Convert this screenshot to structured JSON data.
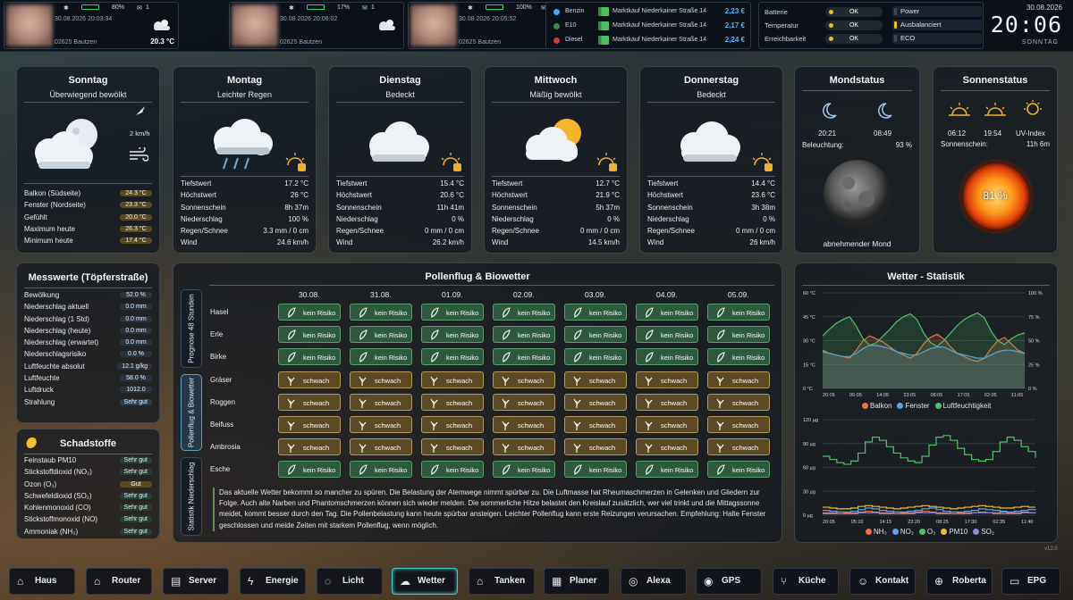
{
  "persons": [
    {
      "battery": "80%",
      "mail": "1",
      "time": "30.08.2026 20:03:34",
      "city": "02625 Bautzen",
      "temp": "20.3 °C"
    },
    {
      "battery": "17%",
      "mail": "1",
      "time": "30.08.2026 20:06:02",
      "city": "02625 Bautzen",
      "temp": ""
    },
    {
      "battery": "100%",
      "mail": "1",
      "time": "30.08.2026 20:05:52",
      "city": "02625 Bautzen",
      "temp": "20.8 °C"
    }
  ],
  "fuel": [
    {
      "name": "Benzin",
      "station": "Marktkauf Niederkainer Straße 14",
      "price": "2,23 €",
      "color": "#4aa3ff"
    },
    {
      "name": "E10",
      "station": "Marktkauf Niederkainer Straße 14",
      "price": "2,17 €",
      "color": "#3a8a4a"
    },
    {
      "name": "Diesel",
      "station": "Marktkauf Niederkainer Straße 14",
      "price": "2,24 €",
      "color": "#d93a3a"
    }
  ],
  "status": [
    {
      "label": "Batterie",
      "value": "OK"
    },
    {
      "label": "Temperatur",
      "value": "OK"
    },
    {
      "label": "Erreichbarkeit",
      "value": "OK"
    }
  ],
  "modes": [
    "Power",
    "Ausbalanciert",
    "ECO"
  ],
  "clock": {
    "date": "30.08.2026",
    "time": "20:06",
    "day": "SONNTAG"
  },
  "today": {
    "day": "Sonntag",
    "desc": "Überwiegend bewölkt",
    "wind": "2 km/h",
    "rows": [
      {
        "label": "Balkon (Südseite)",
        "value": "24.3 °C"
      },
      {
        "label": "Fenster (Nordseite)",
        "value": "23.3 °C"
      },
      {
        "label": "Gefühlt",
        "value": "20.0 °C"
      },
      {
        "label": "Maximum heute",
        "value": "26.3 °C"
      },
      {
        "label": "Minimum heute",
        "value": "17.4 °C"
      }
    ]
  },
  "forecast": [
    {
      "day": "Montag",
      "desc": "Leichter Regen",
      "rows": [
        "17.2 °C",
        "26 °C",
        "8h 37m",
        "100 %",
        "3.3 mm / 0 cm",
        "24.6 km/h"
      ]
    },
    {
      "day": "Dienstag",
      "desc": "Bedeckt",
      "rows": [
        "15.4 °C",
        "20.6 °C",
        "11h 41m",
        "0 %",
        "0 mm / 0 cm",
        "26.2 km/h"
      ]
    },
    {
      "day": "Mittwoch",
      "desc": "Mäßig bewölkt",
      "rows": [
        "12.7 °C",
        "21.9 °C",
        "5h 37m",
        "0 %",
        "0 mm / 0 cm",
        "14.5 km/h"
      ]
    },
    {
      "day": "Donnerstag",
      "desc": "Bedeckt",
      "rows": [
        "14.4 °C",
        "23.6 °C",
        "3h 38m",
        "0 %",
        "0 mm / 0 cm",
        "26 km/h"
      ]
    }
  ],
  "forecast_labels": [
    "Tiefstwert",
    "Höchstwert",
    "Sonnenschein",
    "Niederschlag",
    "Regen/Schnee",
    "Wind"
  ],
  "moon": {
    "title": "Mondstatus",
    "rise": "20:21",
    "set": "08:49",
    "illum_label": "Beleuchtung:",
    "illum": "93 %",
    "phase": "abnehmender Mond"
  },
  "sun": {
    "title": "Sonnenstatus",
    "rise": "06:12",
    "set": "19:54",
    "uv_label": "UV-Index",
    "shine_label": "Sonnenschein:",
    "shine": "11h 6m",
    "percent": "81 %",
    "percent_value": 81
  },
  "messwerte": {
    "title": "Messwerte (Töpferstraße)",
    "rows": [
      {
        "label": "Bewölkung",
        "value": "52.0 %"
      },
      {
        "label": "Niederschlag aktuell",
        "value": "0.0 mm"
      },
      {
        "label": "Niederschlag (1 Std)",
        "value": "0.0 mm"
      },
      {
        "label": "Niederschlag (heute)",
        "value": "0.0 mm"
      },
      {
        "label": "Niederschlag (erwartet)",
        "value": "0.0 mm"
      },
      {
        "label": "Niederschlagsrisiko",
        "value": "0.0 %"
      },
      {
        "label": "Luftfeuchte absolut",
        "value": "12.1 g/kg"
      },
      {
        "label": "Luftfeuchte",
        "value": "58.0 %"
      },
      {
        "label": "Luftdruck",
        "value": "1012.0"
      },
      {
        "label": "Strahlung",
        "value": "Sehr gut"
      }
    ]
  },
  "schadstoffe": {
    "title": "Schadstoffe",
    "rows": [
      {
        "label": "Feinstaub PM10",
        "value": "Sehr gut"
      },
      {
        "label": "Stickstoffdioxid (NO₂)",
        "value": "Sehr gut"
      },
      {
        "label": "Ozon (O₃)",
        "value": "Gut"
      },
      {
        "label": "Schwefeldioxid (SO₂)",
        "value": "Sehr gut"
      },
      {
        "label": "Kohlenmonoxid (CO)",
        "value": "Sehr gut"
      },
      {
        "label": "Stickstoffmonoxid (NO)",
        "value": "Sehr gut"
      },
      {
        "label": "Ammoniak (NH₃)",
        "value": "Sehr gut"
      }
    ]
  },
  "pollen": {
    "title": "Pollenflug & Biowetter",
    "tabs": [
      "Prognose 48 Stunden",
      "Pollenflug & Biowetter",
      "Statistik Niederschlag"
    ],
    "dates": [
      "30.08.",
      "31.08.",
      "01.09.",
      "02.09.",
      "03.09.",
      "04.09.",
      "05.09."
    ],
    "plants": [
      {
        "name": "Hasel",
        "level": "kein Risiko",
        "cls": "g"
      },
      {
        "name": "Erle",
        "level": "kein Risiko",
        "cls": "g"
      },
      {
        "name": "Birke",
        "level": "kein Risiko",
        "cls": "g"
      },
      {
        "name": "Gräser",
        "level": "schwach",
        "cls": "y"
      },
      {
        "name": "Roggen",
        "level": "schwach",
        "cls": "y"
      },
      {
        "name": "Beifuss",
        "level": "schwach",
        "cls": "y"
      },
      {
        "name": "Ambrosia",
        "level": "schwach",
        "cls": "y"
      },
      {
        "name": "Esche",
        "level": "kein Risiko",
        "cls": "g"
      }
    ],
    "text": "Das aktuelle Wetter bekommt so mancher zu spüren. Die Belastung der Atemwege nimmt spürbar zu. Die Luftmasse hat Rheumaschmerzen in Gelenken und Gliedern zur Folge. Auch alte Narben und Phantomschmerzen können sich wieder melden. Die sommerliche Hitze belastet den Kreislauf zusätzlich, wer viel trinkt und die Mittagssonne meidet, kommt besser durch den Tag. Die Pollenbelastung kann heute spürbar ansteigen. Leichter Pollenflug kann erste Reizungen verursachen. Empfehlung: Halte Fenster geschlossen und meide Zeiten mit starkem Pollenflug, wenn möglich."
  },
  "chart_data": [
    {
      "type": "line",
      "title": "Wetter - Statistik",
      "x": [
        "20:05",
        "05:05",
        "14:05",
        "23:05",
        "08:05",
        "17:05",
        "02:05",
        "11:05"
      ],
      "yleft_ticks": [
        "60 °C",
        "45 °C",
        "30 °C",
        "15 °C",
        "0 °C"
      ],
      "yright_ticks": [
        "100 %",
        "75 %",
        "50 %",
        "25 %",
        "0 %"
      ],
      "ylim": [
        0,
        60
      ],
      "y2lim": [
        0,
        100
      ],
      "series": [
        {
          "name": "Balkon",
          "color": "#e8724a",
          "axis": "left",
          "values": [
            24,
            22,
            21,
            20,
            19,
            24,
            30,
            33,
            31,
            29,
            26,
            23,
            21,
            19,
            22,
            28,
            32,
            34,
            31,
            26,
            22,
            20,
            18,
            17,
            19,
            25,
            30,
            32,
            28,
            24,
            22
          ]
        },
        {
          "name": "Fenster",
          "color": "#5aa3e8",
          "axis": "left",
          "values": [
            23,
            22,
            21,
            20,
            20,
            22,
            25,
            27,
            27,
            26,
            25,
            23,
            22,
            21,
            21,
            23,
            25,
            26,
            26,
            24,
            22,
            21,
            20,
            19,
            19,
            21,
            23,
            24,
            24,
            23,
            22
          ]
        },
        {
          "name": "Luftfeuchtigkeit",
          "color": "#4cc36a",
          "axis": "right",
          "values": [
            55,
            62,
            68,
            72,
            75,
            65,
            52,
            45,
            48,
            55,
            62,
            70,
            75,
            78,
            72,
            58,
            48,
            44,
            50,
            58,
            66,
            72,
            76,
            79,
            74,
            60,
            50,
            46,
            52,
            56,
            58
          ]
        }
      ]
    },
    {
      "type": "line",
      "x": [
        "20:05",
        "05:10",
        "14:15",
        "23:20",
        "08:25",
        "17:30",
        "02:35",
        "11:40"
      ],
      "yleft_ticks": [
        "120 µg",
        "90 µg",
        "60 µg",
        "30 µg",
        "0 µg"
      ],
      "ylim": [
        0,
        120
      ],
      "series": [
        {
          "name": "NH₃",
          "color": "#e8724a",
          "values": [
            3,
            3,
            4,
            3,
            3,
            4,
            5,
            4,
            3,
            3,
            4,
            3,
            3,
            4,
            5,
            4,
            3,
            3,
            4,
            3,
            3,
            3,
            4,
            3,
            3,
            4,
            3,
            3,
            4,
            3,
            3
          ]
        },
        {
          "name": "NO₂",
          "color": "#5aa3e8",
          "values": [
            6,
            5,
            4,
            4,
            5,
            7,
            9,
            8,
            6,
            5,
            4,
            4,
            5,
            6,
            8,
            9,
            7,
            5,
            4,
            4,
            5,
            6,
            8,
            7,
            6,
            5,
            4,
            5,
            6,
            7,
            6
          ]
        },
        {
          "name": "O₃",
          "color": "#4cc36a",
          "values": [
            74,
            70,
            66,
            64,
            68,
            78,
            92,
            98,
            94,
            86,
            78,
            72,
            68,
            66,
            74,
            88,
            98,
            100,
            94,
            84,
            76,
            70,
            68,
            70,
            80,
            92,
            98,
            94,
            86,
            80,
            72
          ]
        },
        {
          "name": "PM10",
          "color": "#f0c030",
          "values": [
            10,
            9,
            8,
            8,
            9,
            11,
            12,
            11,
            10,
            9,
            8,
            9,
            10,
            11,
            12,
            11,
            10,
            9,
            8,
            9,
            10,
            11,
            12,
            11,
            10,
            9,
            9,
            10,
            11,
            10,
            10
          ]
        },
        {
          "name": "SO₂",
          "color": "#9a8ad8",
          "values": [
            2,
            2,
            2,
            2,
            2,
            3,
            3,
            3,
            2,
            2,
            2,
            2,
            2,
            3,
            3,
            3,
            2,
            2,
            2,
            2,
            2,
            3,
            3,
            3,
            2,
            2,
            2,
            2,
            3,
            3,
            2
          ]
        }
      ]
    }
  ],
  "version": "v12.0",
  "nav": [
    "Haus",
    "Router",
    "Server",
    "Energie",
    "Licht",
    "Wetter",
    "Tanken",
    "Planer",
    "Alexa",
    "GPS",
    "Küche",
    "Kontakt",
    "Roberta",
    "EPG"
  ]
}
